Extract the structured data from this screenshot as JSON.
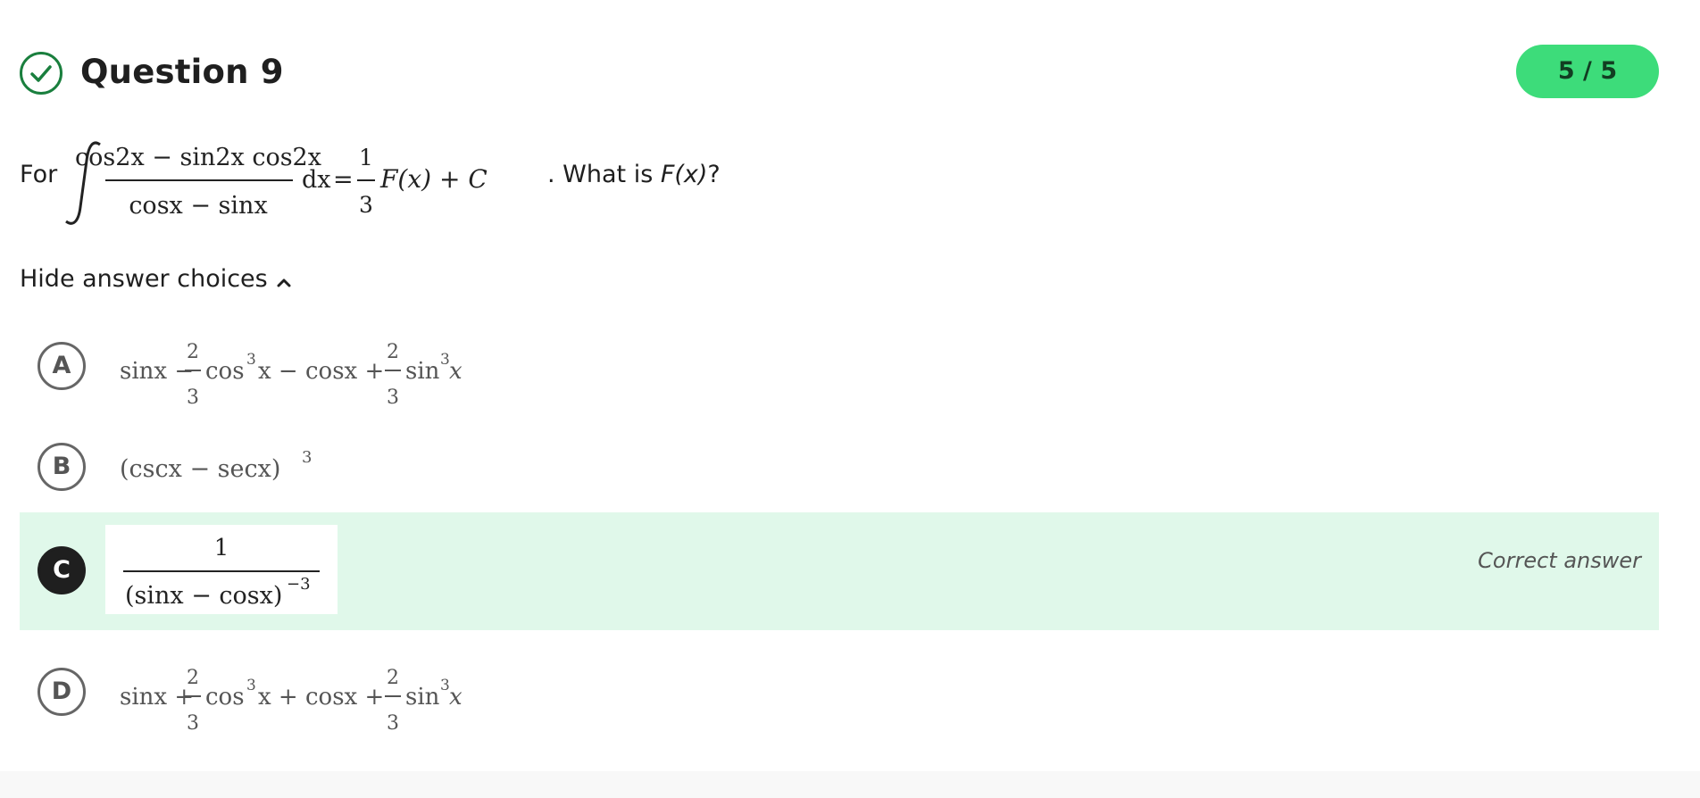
{
  "question": {
    "title": "Question 9",
    "score": "5 / 5",
    "status_icon": "check-circle-icon",
    "prefix": "For",
    "suffix_lead": ". What is ",
    "suffix_fx": "F(x)",
    "suffix_end": "?",
    "integral": {
      "numerator": "cos2x − sin2x cos2x",
      "denominator": "cosx − sinx",
      "dx": "dx",
      "equals": "=",
      "coef_num": "1",
      "coef_den": "3",
      "rhs": "F(x) + C"
    }
  },
  "toggle": {
    "label": "Hide answer choices",
    "icon": "chevron-up-icon"
  },
  "choices": [
    {
      "letter": "A",
      "t1": "sinx −",
      "f1_num": "2",
      "f1_den": "3",
      "t2": "cos",
      "e1": "3",
      "t3": "x − cosx +",
      "f2_num": "2",
      "f2_den": "3",
      "t4": "sin",
      "e2": "3",
      "t5": "x"
    },
    {
      "letter": "B",
      "body": "(cscx − secx)",
      "exp": "3"
    },
    {
      "letter": "C",
      "num": "1",
      "den": "(sinx − cosx)",
      "den_exp": "−3",
      "status": "Correct answer"
    },
    {
      "letter": "D",
      "t1": "sinx +",
      "f1_num": "2",
      "f1_den": "3",
      "t2": "cos",
      "e1": "3",
      "t3": "x + cosx +",
      "f2_num": "2",
      "f2_den": "3",
      "t4": "sin",
      "e2": "3",
      "t5": "x"
    }
  ],
  "colors": {
    "accent_green": "#3ddc7a",
    "correct_bg": "#e0f8ea",
    "check_green": "#1a7f3e"
  }
}
